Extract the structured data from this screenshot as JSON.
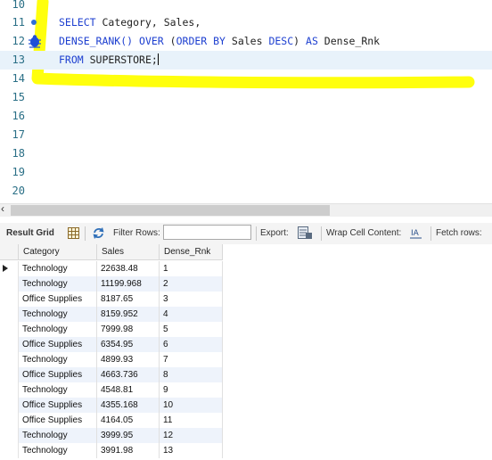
{
  "editor": {
    "line_numbers": [
      "10",
      "11",
      "12",
      "13",
      "14",
      "15",
      "16",
      "17",
      "18",
      "19",
      "20"
    ],
    "query": {
      "l11_select": "SELECT",
      "l11_rest": " Category, Sales,",
      "l12_func": "DENSE_RANK()",
      "l12_over": "OVER",
      "l12_paren": " (",
      "l12_orderby": "ORDER BY",
      "l12_sales": " Sales ",
      "l12_desc": "DESC",
      "l12_close": ") ",
      "l12_as": "AS",
      "l12_alias": " Dense_Rnk",
      "l13_from": "FROM",
      "l13_table": " SUPERSTORE;"
    },
    "highlight_color": "#ffff00",
    "keyword_color": "#1d3fd0"
  },
  "toolbar": {
    "result_grid_label": "Result Grid",
    "filter_rows_label": "Filter Rows:",
    "filter_value": "",
    "export_label": "Export:",
    "wrap_label": "Wrap Cell Content:",
    "fetch_label": "Fetch rows:"
  },
  "grid": {
    "columns": [
      "Category",
      "Sales",
      "Dense_Rnk"
    ],
    "rows": [
      [
        "Technology",
        "22638.48",
        "1"
      ],
      [
        "Technology",
        "11199.968",
        "2"
      ],
      [
        "Office Supplies",
        "8187.65",
        "3"
      ],
      [
        "Technology",
        "8159.952",
        "4"
      ],
      [
        "Technology",
        "7999.98",
        "5"
      ],
      [
        "Office Supplies",
        "6354.95",
        "6"
      ],
      [
        "Technology",
        "4899.93",
        "7"
      ],
      [
        "Office Supplies",
        "4663.736",
        "8"
      ],
      [
        "Technology",
        "4548.81",
        "9"
      ],
      [
        "Office Supplies",
        "4355.168",
        "10"
      ],
      [
        "Office Supplies",
        "4164.05",
        "11"
      ],
      [
        "Technology",
        "3999.95",
        "12"
      ],
      [
        "Technology",
        "3991.98",
        "13"
      ]
    ]
  }
}
